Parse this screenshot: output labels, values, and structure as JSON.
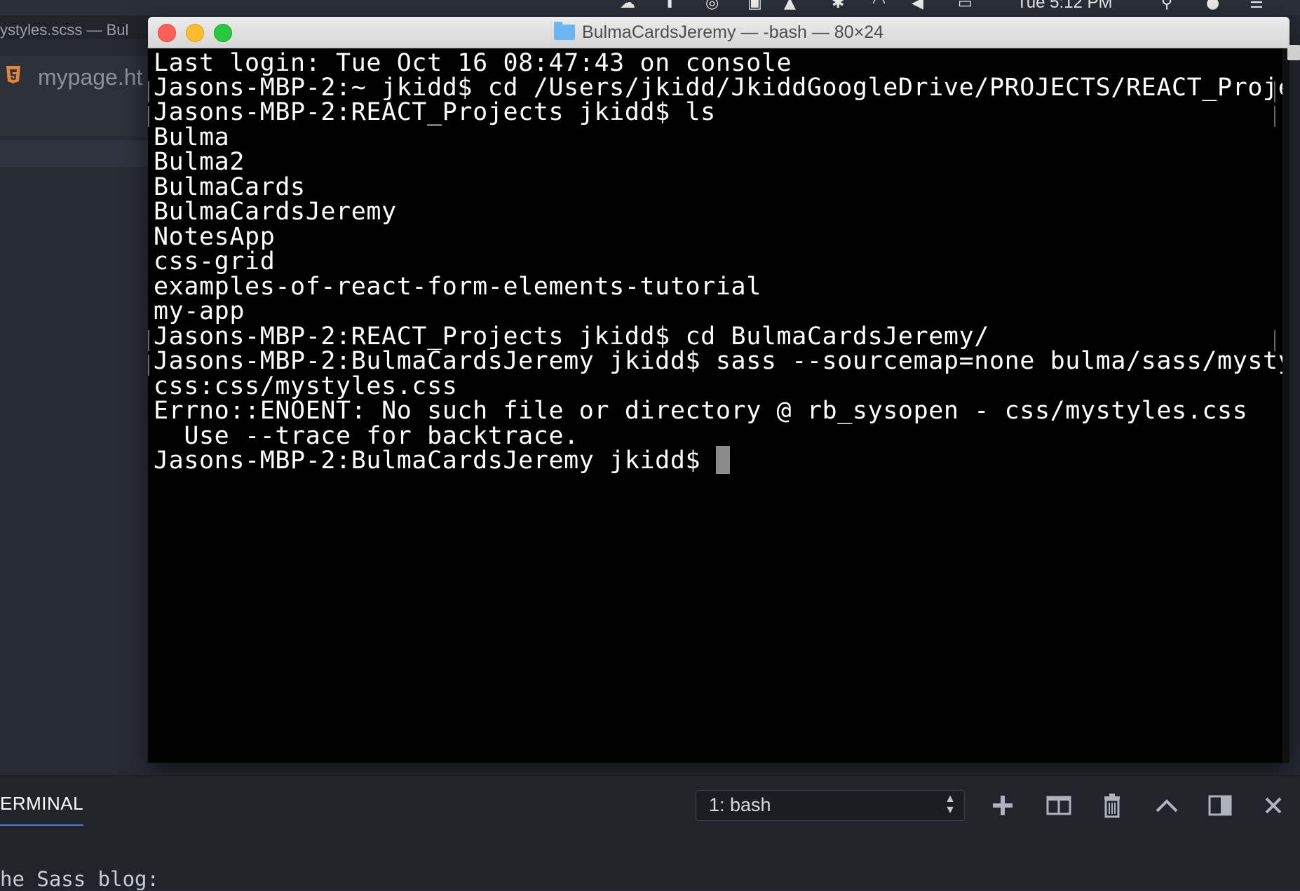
{
  "menubar": {
    "clock": "Tue 5:12 PM",
    "icons": [
      "creative-cloud-icon",
      "upload-cloud-icon",
      "1password-icon",
      "evernote-icon",
      "airplay-icon",
      "bluetooth-icon",
      "wifi-icon",
      "volume-icon",
      "battery-icon",
      "search-icon",
      "siri-icon",
      "list-icon"
    ]
  },
  "editor": {
    "window_title": "ystyles.scss — Bul",
    "tab_label": "mypage.ht"
  },
  "terminal": {
    "title": "BulmaCardsJeremy — -bash — 80×24",
    "lines": [
      "Last login: Tue Oct 16 08:47:43 on console",
      "Jasons-MBP-2:~ jkidd$ cd /Users/jkidd/JkiddGoogleDrive/PROJECTS/REACT_Projects",
      "Jasons-MBP-2:REACT_Projects jkidd$ ls",
      "Bulma",
      "Bulma2",
      "BulmaCards",
      "BulmaCardsJeremy",
      "NotesApp",
      "css-grid",
      "examples-of-react-form-elements-tutorial",
      "my-app",
      "Jasons-MBP-2:REACT_Projects jkidd$ cd BulmaCardsJeremy/",
      "Jasons-MBP-2:BulmaCardsJeremy jkidd$ sass --sourcemap=none bulma/sass/mystyles.s",
      "css:css/mystyles.css",
      "Errno::ENOENT: No such file or directory @ rb_sysopen - css/mystyles.css",
      "  Use --trace for backtrace.",
      "Jasons-MBP-2:BulmaCardsJeremy jkidd$ "
    ]
  },
  "panel": {
    "tab_label": "ERMINAL",
    "selected_terminal": "1: bash",
    "bottom_text": "he Sass blog:"
  }
}
